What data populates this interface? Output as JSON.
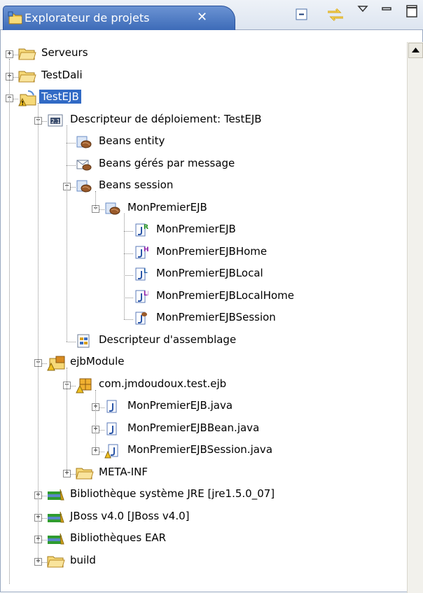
{
  "view": {
    "title": "Explorateur de projets",
    "close_glyph": "✕",
    "toolbar": [
      "collapse-all-icon",
      "link-with-editor-icon",
      "view-menu-icon",
      "minimize-icon",
      "maximize-icon"
    ]
  },
  "tree": [
    {
      "label": "Serveurs",
      "icon": "folder-icon",
      "expander": "+"
    },
    {
      "label": "TestDali",
      "icon": "project-folder-icon",
      "expander": "+"
    },
    {
      "label": "TestEJB",
      "icon": "ejb-project-icon",
      "expander": "−",
      "selected": true
    },
    {
      "label": "Descripteur de déploiement: TestEJB",
      "icon": "deployment-descriptor-icon",
      "expander": "−"
    },
    {
      "label": "Beans entity",
      "icon": "entity-bean-icon",
      "expander": ""
    },
    {
      "label": "Beans gérés par message",
      "icon": "message-bean-icon",
      "expander": ""
    },
    {
      "label": "Beans session",
      "icon": "session-bean-icon",
      "expander": "−"
    },
    {
      "label": "MonPremierEJB",
      "icon": "session-bean-icon",
      "expander": "−"
    },
    {
      "label": "MonPremierEJB",
      "icon": "remote-interface-icon",
      "expander": ""
    },
    {
      "label": "MonPremierEJBHome",
      "icon": "home-interface-icon",
      "expander": ""
    },
    {
      "label": "MonPremierEJBLocal",
      "icon": "local-interface-icon",
      "expander": ""
    },
    {
      "label": "MonPremierEJBLocalHome",
      "icon": "local-home-interface-icon",
      "expander": ""
    },
    {
      "label": "MonPremierEJBSession",
      "icon": "bean-class-icon",
      "expander": ""
    },
    {
      "label": "Descripteur d'assemblage",
      "icon": "assembly-descriptor-icon",
      "expander": ""
    },
    {
      "label": "ejbModule",
      "icon": "source-folder-icon",
      "expander": "−"
    },
    {
      "label": "com.jmdoudoux.test.ejb",
      "icon": "package-icon",
      "expander": "−"
    },
    {
      "label": "MonPremierEJB.java",
      "icon": "java-file-icon",
      "expander": "+"
    },
    {
      "label": "MonPremierEJBBean.java",
      "icon": "java-file-icon",
      "expander": "+"
    },
    {
      "label": "MonPremierEJBSession.java",
      "icon": "java-file-warning-icon",
      "expander": "+"
    },
    {
      "label": "META-INF",
      "icon": "folder-icon",
      "expander": "+"
    },
    {
      "label": "Bibliothèque système JRE [jre1.5.0_07]",
      "icon": "library-icon",
      "expander": "+"
    },
    {
      "label": "JBoss v4.0 [JBoss v4.0]",
      "icon": "library-icon",
      "expander": "+"
    },
    {
      "label": "Bibliothèques EAR",
      "icon": "library-icon",
      "expander": "+"
    },
    {
      "label": "build",
      "icon": "folder-icon",
      "expander": "+"
    }
  ]
}
